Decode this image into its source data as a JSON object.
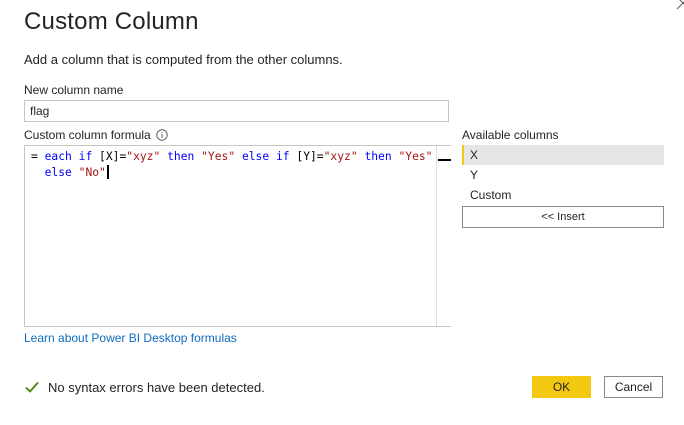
{
  "dialog": {
    "title": "Custom Column",
    "subtitle": "Add a column that is computed from the other columns."
  },
  "name_field": {
    "label": "New column name",
    "value": "flag"
  },
  "formula_field": {
    "label": "Custom column formula",
    "line1": {
      "t1": "= ",
      "t2": "each",
      "t3": " ",
      "t4": "if",
      "t5": " [X]=",
      "t6": "\"xyz\"",
      "t7": " ",
      "t8": "then",
      "t9": " ",
      "t10": "\"Yes\"",
      "t11": " ",
      "t12": "else",
      "t13": " ",
      "t14": "if",
      "t15": " [Y]=",
      "t16": "\"xyz\"",
      "t17": " ",
      "t18": "then",
      "t19": " ",
      "t20": "\"Yes\""
    },
    "line2": {
      "t1": "  ",
      "t2": "else",
      "t3": " ",
      "t4": "\"No\""
    }
  },
  "learn_link": "Learn about Power BI Desktop formulas",
  "available_columns": {
    "label": "Available columns",
    "items": [
      "X",
      "Y",
      "Custom"
    ],
    "selected": "X",
    "insert_label": "<< Insert"
  },
  "status": {
    "text": "No syntax errors have been detected.",
    "icon": "check-icon"
  },
  "buttons": {
    "ok": "OK",
    "cancel": "Cancel"
  },
  "colors": {
    "accent": "#f2c811",
    "link": "#0f6cbd",
    "keyword": "#0000ff",
    "string": "#a31515",
    "success": "#498205"
  }
}
